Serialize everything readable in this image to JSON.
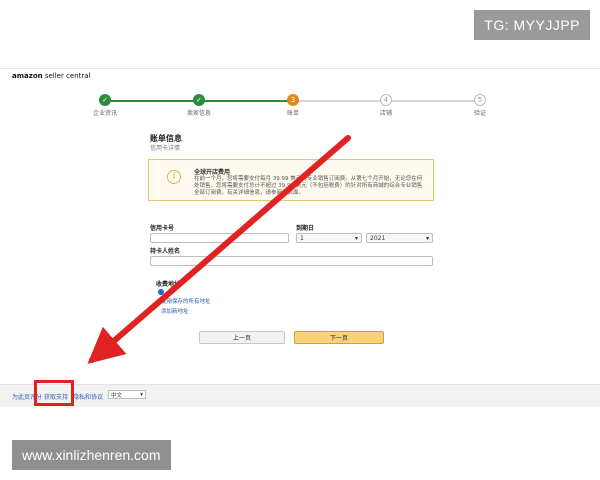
{
  "watermarks": {
    "top_right": "TG: MYYJJPP",
    "bottom_left": "www.xinlizhenren.com"
  },
  "header": {
    "logo_amazon": "amazon",
    "logo_rest": " seller central"
  },
  "stepper": {
    "steps": [
      {
        "label": "企业资讯",
        "symbol": "✓",
        "state": "done"
      },
      {
        "label": "卖家信息",
        "symbol": "✓",
        "state": "done"
      },
      {
        "label": "账单",
        "symbol": "3",
        "state": "current"
      },
      {
        "label": "店铺",
        "symbol": "4",
        "state": "todo"
      },
      {
        "label": "验证",
        "symbol": "5",
        "state": "todo"
      }
    ]
  },
  "page": {
    "title": "账单信息",
    "subtitle": "信用卡详情"
  },
  "notice": {
    "title": "全球开店费用",
    "text": "在前一个月，您将需要支付每月 39.99 美元的专业销售订阅费。从第七个月开始，无论您在何处销售，您将需要支付总计不超过 39.99 美元（不包括税费）的针对所有商城的综合专业销售全部订阅费。有关详细信息，请参阅此页面。"
  },
  "form": {
    "card_number_label": "信用卡号",
    "expiry_label": "到期日",
    "month_value": "1",
    "year_value": "2021",
    "holder_label": "持卡人姓名",
    "billing_address_label": "收费地址",
    "saved_address_text": "使用保存的所有地址",
    "add_address_text": "添加新地址"
  },
  "buttons": {
    "prev": "上一页",
    "next": "下一页"
  },
  "footer": {
    "link1": "为此页评分",
    "link2": "获取支持",
    "link3": "隐私和协议",
    "language": "中文"
  },
  "colors": {
    "done": "#2e8b3d",
    "current": "#e08a16",
    "link": "#2a62b6",
    "arrow": "#e12222"
  },
  "icons": {
    "chevron": "▾",
    "info": "i"
  }
}
